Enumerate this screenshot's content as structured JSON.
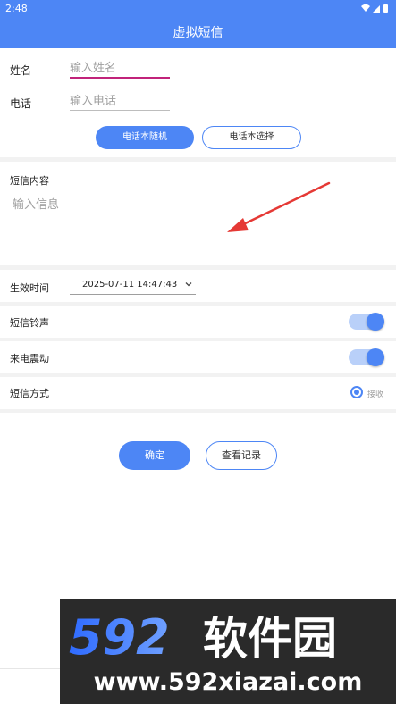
{
  "status_bar": {
    "time": "2:48"
  },
  "app_bar": {
    "title": "虚拟短信"
  },
  "contact": {
    "name_label": "姓名",
    "name_placeholder": "输入姓名",
    "phone_label": "电话",
    "phone_placeholder": "输入电话",
    "random_button": "电话本随机",
    "select_button": "电话本选择"
  },
  "message": {
    "label": "短信内容",
    "placeholder": "输入信息"
  },
  "settings": {
    "effective_time_label": "生效时间",
    "effective_time_value": "2025-07-11 14:47:43",
    "ringtone_label": "短信铃声",
    "ringtone_on": true,
    "vibrate_label": "来电震动",
    "vibrate_on": true,
    "mode_label": "短信方式",
    "mode_option": "接收"
  },
  "actions": {
    "confirm": "确定",
    "view_records": "查看记录"
  },
  "watermark": {
    "brand": "592软件园",
    "url": "www.592xiazai.com"
  },
  "colors": {
    "accent": "#4d86f5",
    "focus_underline": "#c1237a",
    "arrow": "#e53935"
  }
}
